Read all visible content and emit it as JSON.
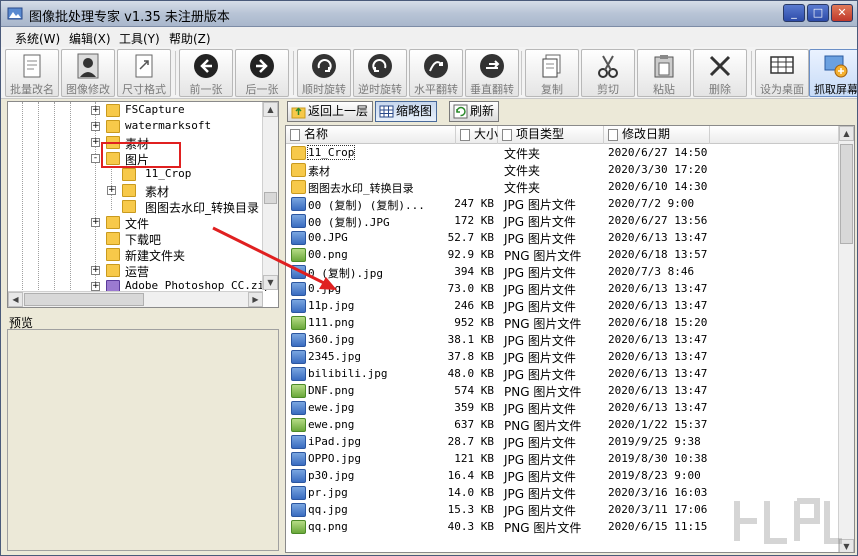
{
  "window": {
    "title": "图像批处理专家 v1.35 未注册版本"
  },
  "menu": [
    {
      "label": "系统(W)"
    },
    {
      "label": "编辑(X)"
    },
    {
      "label": "工具(Y)"
    },
    {
      "label": "帮助(Z)"
    }
  ],
  "toolbar": [
    {
      "label": "批量改名",
      "icon": "rename-doc-icon"
    },
    {
      "label": "图像修改",
      "icon": "portrait-icon"
    },
    {
      "label": "尺寸格式",
      "icon": "resize-doc-icon"
    },
    {
      "label": "前一张",
      "icon": "arrow-left-icon"
    },
    {
      "label": "后一张",
      "icon": "arrow-right-icon"
    },
    {
      "label": "顺时旋转",
      "icon": "rotate-cw-icon"
    },
    {
      "label": "逆时旋转",
      "icon": "rotate-ccw-icon"
    },
    {
      "label": "水平翻转",
      "icon": "flip-horizontal-icon"
    },
    {
      "label": "垂直翻转",
      "icon": "flip-vertical-icon"
    },
    {
      "label": "复制",
      "icon": "copy-icon"
    },
    {
      "label": "剪切",
      "icon": "scissors-icon"
    },
    {
      "label": "粘贴",
      "icon": "paste-icon"
    },
    {
      "label": "删除",
      "icon": "delete-x-icon"
    },
    {
      "label": "设为桌面",
      "icon": "desktop-grid-icon"
    },
    {
      "label": "抓取屏幕",
      "icon": "capture-screen-icon"
    }
  ],
  "tree": {
    "items": [
      {
        "label": "FSCapture",
        "expand": "+"
      },
      {
        "label": "watermarksoft",
        "expand": "+"
      },
      {
        "label": "素材",
        "expand": "+"
      },
      {
        "label": "图片",
        "expand": "-"
      },
      {
        "label": "11_Crop",
        "expand": ""
      },
      {
        "label": "素材",
        "expand": "+"
      },
      {
        "label": "图图去水印_转换目录",
        "expand": ""
      },
      {
        "label": "文件",
        "expand": "+"
      },
      {
        "label": "下载吧",
        "expand": ""
      },
      {
        "label": "新建文件夹",
        "expand": ""
      },
      {
        "label": "运营",
        "expand": "+"
      },
      {
        "label": "Adobe Photoshop CC.zip",
        "expand": "+"
      }
    ]
  },
  "preview": {
    "label": "预览"
  },
  "path_bar": {
    "back_label": "返回上一层",
    "thumb_label": "缩略图",
    "refresh_label": "刷新"
  },
  "file_list": {
    "columns": [
      "名称",
      "大小",
      "项目类型",
      "修改日期"
    ],
    "rows": [
      {
        "name": "11_Crop",
        "size": "",
        "type": "文件夹",
        "date": "2020/6/27 14:50",
        "kind": "folder"
      },
      {
        "name": "素材",
        "size": "",
        "type": "文件夹",
        "date": "2020/3/30 17:20",
        "kind": "folder"
      },
      {
        "name": "图图去水印_转换目录",
        "size": "",
        "type": "文件夹",
        "date": "2020/6/10 14:30",
        "kind": "folder"
      },
      {
        "name": "00 (复制) (复制)...",
        "size": "247 KB",
        "type": "JPG 图片文件",
        "date": "2020/7/2 9:00",
        "kind": "jpg"
      },
      {
        "name": "00 (复制).JPG",
        "size": "172 KB",
        "type": "JPG 图片文件",
        "date": "2020/6/27 13:56",
        "kind": "jpg"
      },
      {
        "name": "00.JPG",
        "size": "52.7 KB",
        "type": "JPG 图片文件",
        "date": "2020/6/13 13:47",
        "kind": "jpg"
      },
      {
        "name": "00.png",
        "size": "92.9 KB",
        "type": "PNG 图片文件",
        "date": "2020/6/18 13:57",
        "kind": "png"
      },
      {
        "name": "0 (复制).jpg",
        "size": "394 KB",
        "type": "JPG 图片文件",
        "date": "2020/7/3 8:46",
        "kind": "jpg"
      },
      {
        "name": "0.jpg",
        "size": "73.0 KB",
        "type": "JPG 图片文件",
        "date": "2020/6/13 13:47",
        "kind": "jpg"
      },
      {
        "name": "11p.jpg",
        "size": "246 KB",
        "type": "JPG 图片文件",
        "date": "2020/6/13 13:47",
        "kind": "jpg"
      },
      {
        "name": "111.png",
        "size": "952 KB",
        "type": "PNG 图片文件",
        "date": "2020/6/18 15:20",
        "kind": "png"
      },
      {
        "name": "360.jpg",
        "size": "38.1 KB",
        "type": "JPG 图片文件",
        "date": "2020/6/13 13:47",
        "kind": "jpg"
      },
      {
        "name": "2345.jpg",
        "size": "37.8 KB",
        "type": "JPG 图片文件",
        "date": "2020/6/13 13:47",
        "kind": "jpg"
      },
      {
        "name": "bilibili.jpg",
        "size": "48.0 KB",
        "type": "JPG 图片文件",
        "date": "2020/6/13 13:47",
        "kind": "jpg"
      },
      {
        "name": "DNF.png",
        "size": "574 KB",
        "type": "PNG 图片文件",
        "date": "2020/6/13 13:47",
        "kind": "png"
      },
      {
        "name": "ewe.jpg",
        "size": "359 KB",
        "type": "JPG 图片文件",
        "date": "2020/6/13 13:47",
        "kind": "jpg"
      },
      {
        "name": "ewe.png",
        "size": "637 KB",
        "type": "PNG 图片文件",
        "date": "2020/1/22 15:37",
        "kind": "png"
      },
      {
        "name": "iPad.jpg",
        "size": "28.7 KB",
        "type": "JPG 图片文件",
        "date": "2019/9/25 9:38",
        "kind": "jpg"
      },
      {
        "name": "OPPO.jpg",
        "size": "121 KB",
        "type": "JPG 图片文件",
        "date": "2019/8/30 10:38",
        "kind": "jpg"
      },
      {
        "name": "p30.jpg",
        "size": "16.4 KB",
        "type": "JPG 图片文件",
        "date": "2019/8/23 9:00",
        "kind": "jpg"
      },
      {
        "name": "pr.jpg",
        "size": "14.0 KB",
        "type": "JPG 图片文件",
        "date": "2020/3/16 16:03",
        "kind": "jpg"
      },
      {
        "name": "qq.jpg",
        "size": "15.3 KB",
        "type": "JPG 图片文件",
        "date": "2020/3/11 17:06",
        "kind": "jpg"
      },
      {
        "name": "qq.png",
        "size": "40.3 KB",
        "type": "PNG 图片文件",
        "date": "2020/6/15 11:15",
        "kind": "png"
      }
    ]
  },
  "colors": {
    "highlight_box": "#e02020",
    "arrow": "#e02020"
  }
}
